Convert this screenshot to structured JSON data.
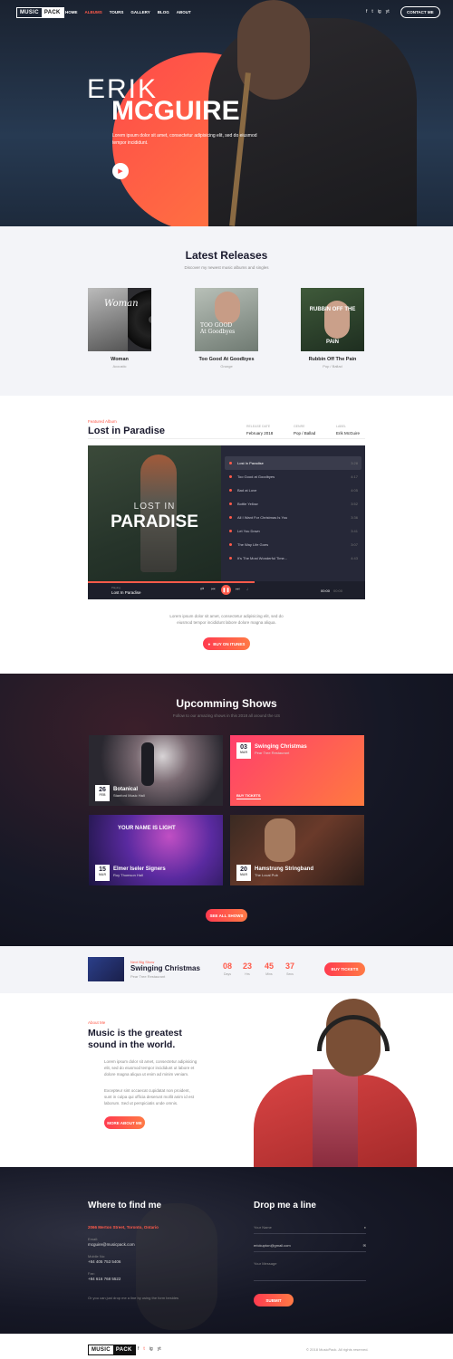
{
  "header": {
    "logo_a": "MUSIC",
    "logo_b": "PACK",
    "nav": [
      "HOME",
      "ALBUMS",
      "TOURS",
      "GALLERY",
      "BLOG",
      "ABOUT"
    ],
    "social": [
      "f",
      "t",
      "ig",
      "yt"
    ],
    "contact_btn": "CONTACT ME"
  },
  "hero": {
    "first": "ERIK",
    "last": "MCGUIRE",
    "text": "Lorem ipsum dolor sit amet, consectetur adipisicing elit, sed do eiusmod tempor incididunt."
  },
  "releases": {
    "title": "Latest Releases",
    "subtitle": "Discover my newest music albums and singles",
    "albums": [
      {
        "cover": "Woman",
        "name": "Woman",
        "genre": "Acoustic"
      },
      {
        "cover": "TOO GOOD At Goodbyes",
        "name": "Too Good At Goodbyes",
        "genre": "Grunge"
      },
      {
        "cover": "RUBBIN OFF THE PAIN",
        "name": "Rubbin Off The Pain",
        "genre": "Pop / Ballad"
      }
    ]
  },
  "featured": {
    "label": "Featured Album",
    "title": "Lost in Paradise",
    "meta": [
      {
        "label": "Release date",
        "value": "February 2018"
      },
      {
        "label": "Genre",
        "value": "Pop / Ballad"
      },
      {
        "label": "Label",
        "value": "Erik McGuire"
      }
    ],
    "cover_small": "LOST IN",
    "cover_big": "PARADISE",
    "tracks": [
      {
        "name": "Lost In Paradise",
        "dur": "3:28"
      },
      {
        "name": "Too Good at Goodbyes",
        "dur": "4:17"
      },
      {
        "name": "Bad at Love",
        "dur": "4:05"
      },
      {
        "name": "Bottle Yellow",
        "dur": "3:52"
      },
      {
        "name": "All I Want For Christmas Is You",
        "dur": "3:36"
      },
      {
        "name": "Let You Down",
        "dur": "3:41"
      },
      {
        "name": "The Way Life Goes",
        "dur": "3:07"
      },
      {
        "name": "It's The Most Wonderful Time...",
        "dur": "4:43"
      }
    ],
    "now_label": "Playing",
    "now_title": "Lost In Paradise",
    "time_now": "00:00",
    "time_total": "00:00",
    "progress": 0.6,
    "desc": "Lorem ipsum dolor sit amet, consectetur adipisicing elit, sed do eiusmod tempor incididunt labore dolore magna aliqua.",
    "itunes_btn": "BUY ON ITUNES"
  },
  "shows": {
    "title": "Upcomming Shows",
    "subtitle": "Follow to our amazing shows in this 2018 all around the US",
    "items": [
      {
        "day": "26",
        "mon": "FEB",
        "name": "Botanical",
        "venue": "Stanford Music Hall"
      },
      {
        "day": "03",
        "mon": "MAR",
        "name": "Swinging Christmas",
        "venue": "Pear Tree Restaurant",
        "ticket": "BUY TICKETS"
      },
      {
        "day": "15",
        "mon": "MAR",
        "name": "Elmer Iseler Signers",
        "venue": "Roy Thomson Hall",
        "sign": "YOUR NAME IS LIGHT"
      },
      {
        "day": "20",
        "mon": "MAR",
        "name": "Hamstrung Stringband",
        "venue": "The Local Pub"
      }
    ],
    "see_all": "SEE ALL SHOWS"
  },
  "countdown": {
    "label": "Next Big Show",
    "title": "Swinging Christmas",
    "venue": "Pear Tree Restaurant",
    "units": [
      {
        "num": "08",
        "lab": "Days"
      },
      {
        "num": "23",
        "lab": "Hrs"
      },
      {
        "num": "45",
        "lab": "Mins"
      },
      {
        "num": "37",
        "lab": "Secs"
      }
    ],
    "btn": "BUY TICKETS"
  },
  "about": {
    "label": "About Me",
    "title_1": "Music is the greatest",
    "title_2": "sound in the world.",
    "p1": "Lorem ipsum dolor sit amet, consectetur adipisicing elit, sed do eiusmod tempor incididunt ut labore et dolore magna aliqua ut enim ad minim veniam.",
    "p2": "Excepteur sint occaecat cupidatat non proident, sunt in culpa qui officia deserunt mollit anim id est laborum. Sed ut perspiciatis unde omnis.",
    "btn": "MORE ABOUT ME"
  },
  "contact": {
    "find_title": "Where to find me",
    "address": "2066 Merton Street, Toronto, Ontario",
    "email_label": "Email:",
    "email": "mcguire@musicpack.com",
    "mobile_label": "Mobile No:",
    "mobile": "+84 405 753 5406",
    "fax_label": "Fax:",
    "fax": "+84 616 768 5522",
    "note": "Or you can just drop me a line by using the form besides",
    "form_title": "Drop me a line",
    "name_ph": "Your Name",
    "email_ph": "erickupton@gmail.com",
    "message_ph": "Your Message",
    "submit": "SUBMIT"
  },
  "footer": {
    "logo_a": "MUSIC",
    "logo_b": "PACK",
    "social": [
      "f",
      "t",
      "ig",
      "yt"
    ],
    "copyright": "© 2018 MusicPack. All rights reserved."
  },
  "colors": {
    "accent": "#ff5a4a",
    "dark": "#161826",
    "light_bg": "#f3f4f8"
  },
  "icons": [
    "play-icon",
    "pause-icon",
    "prev-icon",
    "next-icon",
    "shuffle-icon",
    "volume-icon",
    "user-icon",
    "mail-icon",
    "apple-icon"
  ]
}
